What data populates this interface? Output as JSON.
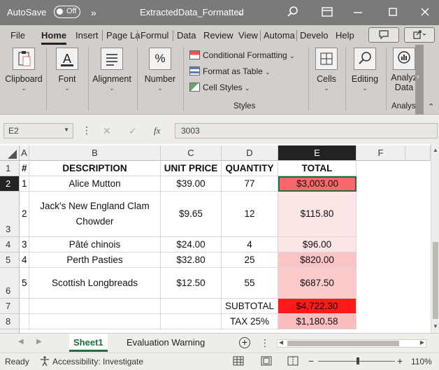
{
  "titlebar": {
    "autosave_label": "AutoSave",
    "autosave_state": "Off",
    "more_glyph": "»",
    "file_title": "ExtractedData_Formatted",
    "title_chevron": "⌄"
  },
  "tabs": [
    "File",
    "Home",
    "Insert",
    "Page Layout",
    "Formulas",
    "Data",
    "Review",
    "View",
    "Automate",
    "Developer",
    "Help"
  ],
  "tab_display": [
    "File",
    "Home",
    "Insert",
    "Page La",
    "Formul",
    "Data",
    "Review",
    "View",
    "Automa",
    "Develo",
    "Help"
  ],
  "active_tab": "Home",
  "ribbon": {
    "clipboard": "Clipboard",
    "font": "Font",
    "alignment": "Alignment",
    "number": "Number",
    "conditional_formatting": "Conditional Formatting",
    "format_as_table": "Format as Table",
    "cell_styles": "Cell Styles",
    "styles_group": "Styles",
    "cells": "Cells",
    "editing": "Editing",
    "analyze_line1": "Analyz",
    "analyze_line2": "Data",
    "analysis_group": "Analys",
    "number_glyph": "%",
    "font_glyph": "A"
  },
  "formula_bar": {
    "name_box": "E2",
    "fx": "fx",
    "value": "3003"
  },
  "columns": [
    "A",
    "B",
    "C",
    "D",
    "E",
    "F"
  ],
  "selected_column": "E",
  "rows": [
    "1",
    "2",
    "3",
    "4",
    "5",
    "6",
    "7",
    "8"
  ],
  "selected_row": "2",
  "table": {
    "header": [
      "#",
      "DESCRIPTION",
      "UNIT PRICE",
      "QUANTITY",
      "TOTAL"
    ],
    "items": [
      {
        "num": "1",
        "description": "Alice Mutton",
        "unit_price": "$39.00",
        "quantity": "77",
        "total": "$3,003.00",
        "fill": "#f8696b"
      },
      {
        "num": "2",
        "description": "Jack's New England Clam Chowder",
        "unit_price": "$9.65",
        "quantity": "12",
        "total": "$115.80",
        "fill": "#fde4e5"
      },
      {
        "num": "3",
        "description": "Pâté chinois",
        "unit_price": "$24.00",
        "quantity": "4",
        "total": "$96.00",
        "fill": "#fde4e5"
      },
      {
        "num": "4",
        "description": "Perth Pasties",
        "unit_price": "$32.80",
        "quantity": "25",
        "total": "$820.00",
        "fill": "#fbc4c5"
      },
      {
        "num": "5",
        "description": "Scottish Longbreads",
        "unit_price": "$12.50",
        "quantity": "55",
        "total": "$687.50",
        "fill": "#fbcacb"
      }
    ],
    "subtotal_label": "SUBTOTAL",
    "subtotal_value": "$4,722.30",
    "subtotal_fill": "#ff1a1a",
    "tax_label": "TAX 25%",
    "tax_value": "$1,180.58",
    "tax_fill": "#fbbcbd"
  },
  "sheets": [
    "Sheet1",
    "Evaluation Warning"
  ],
  "active_sheet": "Sheet1",
  "status": {
    "ready": "Ready",
    "accessibility": "Accessibility: Investigate",
    "zoom": "110%"
  },
  "colors": {
    "titlebar_bg": "#7a7a7a",
    "ribbon_bg": "#d2cfca",
    "active_sheet": "#1f6f3b",
    "selection_border": "#1f6f3b"
  }
}
